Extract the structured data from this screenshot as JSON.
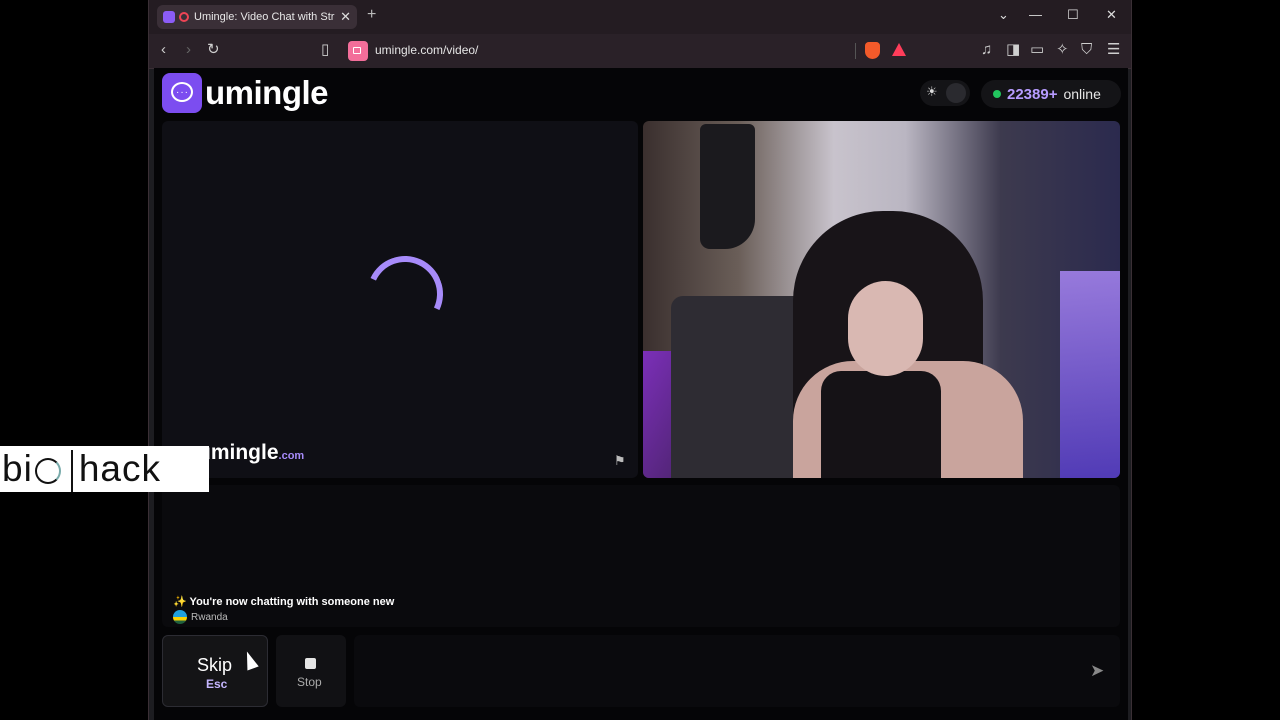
{
  "browser": {
    "tab_title": "Umingle: Video Chat with Str",
    "url": "umingle.com/video/"
  },
  "site": {
    "logo_text": "umingle",
    "online_count": "22389+",
    "online_label": "online"
  },
  "video": {
    "watermark": "umingle",
    "watermark_suffix": ".com"
  },
  "chat": {
    "system_message": "✨ You're now chatting with someone new",
    "country": "Rwanda"
  },
  "controls": {
    "skip_label": "Skip",
    "skip_key": "Esc",
    "stop_label": "Stop",
    "message_placeholder": ""
  },
  "overlay": {
    "left": "bi",
    "right": "hack"
  },
  "colors": {
    "accent": "#7c4df0",
    "online_dot": "#22c55e",
    "count": "#b79cff"
  }
}
